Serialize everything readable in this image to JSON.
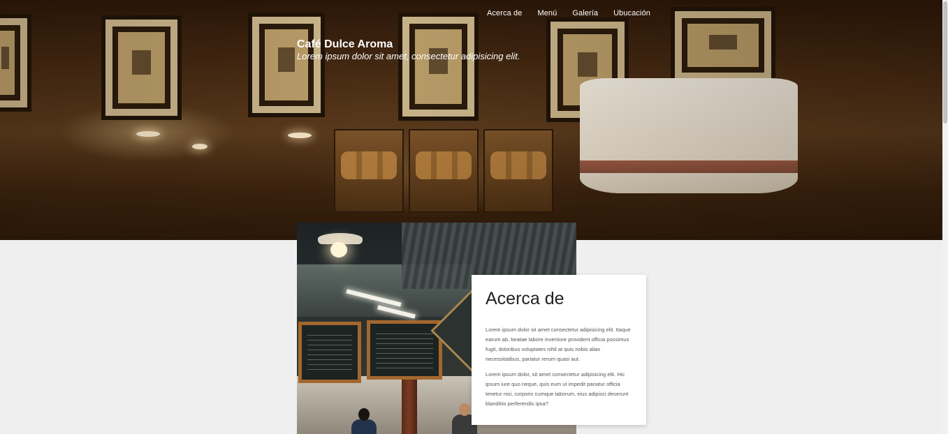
{
  "nav": {
    "items": [
      {
        "label": "Acerca de"
      },
      {
        "label": "Menú"
      },
      {
        "label": "Galería"
      },
      {
        "label": "Ubucación"
      }
    ]
  },
  "brand": {
    "title": "Café Dulce Aroma",
    "tagline": "Lorem ipsum dolor sit amet, consectetur adipisicing elit."
  },
  "about": {
    "heading": "Acerca de",
    "paragraphs": [
      "Lorem ipsum dolor sit amet consectetur adipisicing elit. Itaque earum ab, beatae labore inventore provident officia possimus fugit, doloribus voluptates nihil at quis nobis alias necessitatibus, pariatur rerum quasi aut.",
      "Lorem ipsum dolor, sit amet consectetur adipisicing elit. Hic ipsum iure quo neque, quis eum ut impedit pariatur officia tenetur nisi, corporis cumque laborum, eius adipisci deserunt blanditiis perferendis ipsa?"
    ]
  },
  "colors": {
    "hero_overlay": "#2a1608",
    "page_background": "#efefef",
    "card_background": "#ffffff",
    "text_light": "#ffffff",
    "heading_dark": "#222222"
  }
}
